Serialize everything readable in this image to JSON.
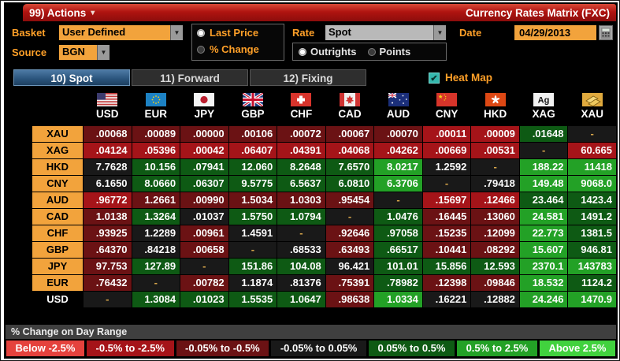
{
  "title_bar": {
    "actions_label": "99) Actions",
    "title": "Currency Rates Matrix (FXC)"
  },
  "controls": {
    "basket_label": "Basket",
    "basket_value": "User Defined",
    "source_label": "Source",
    "source_value": "BGN",
    "price_options": [
      {
        "label": "Last Price",
        "selected": true
      },
      {
        "label": "% Change",
        "selected": false
      }
    ],
    "rate_label": "Rate",
    "rate_value": "Spot",
    "rate_type_options": [
      {
        "label": "Outrights",
        "selected": true
      },
      {
        "label": "Points",
        "selected": false
      }
    ],
    "date_label": "Date",
    "date_value": "04/29/2013"
  },
  "tabs": [
    {
      "label": "10) Spot",
      "selected": true
    },
    {
      "label": "11) Forward",
      "selected": false
    },
    {
      "label": "12) Fixing",
      "selected": false
    }
  ],
  "heat_map": {
    "label": "Heat Map",
    "checked": true
  },
  "colors": {
    "accent_orange": "#f2a33c",
    "titlebar_red": "#b01410",
    "tab_selected_blue": "#2c567e",
    "heatmap_teal": "#35b7ad",
    "dash_amber": "#d8a64b",
    "screen_background": "#000000"
  },
  "heat_colors": {
    "br": "#e5423d",
    "mr": "#a51419",
    "dr": "#6b1214",
    "blk": "#191919",
    "dg": "#0e5a14",
    "mg": "#23a126",
    "bg": "#41d23e"
  },
  "matrix": {
    "columns": [
      {
        "code": "USD",
        "icon": "usd-flag-icon"
      },
      {
        "code": "EUR",
        "icon": "eur-flag-icon"
      },
      {
        "code": "JPY",
        "icon": "jpy-flag-icon"
      },
      {
        "code": "GBP",
        "icon": "gbp-flag-icon"
      },
      {
        "code": "CHF",
        "icon": "chf-flag-icon"
      },
      {
        "code": "CAD",
        "icon": "cad-flag-icon"
      },
      {
        "code": "AUD",
        "icon": "aud-flag-icon"
      },
      {
        "code": "CNY",
        "icon": "cny-flag-icon"
      },
      {
        "code": "HKD",
        "icon": "hkd-flag-icon"
      },
      {
        "code": "XAG",
        "icon": "silver-ag-icon"
      },
      {
        "code": "XAU",
        "icon": "gold-bars-icon"
      }
    ],
    "rows": [
      {
        "label": "XAU",
        "highlight": true,
        "cells": [
          [
            ".00068",
            "dr"
          ],
          [
            ".00089",
            "dr"
          ],
          [
            ".00000",
            "dr"
          ],
          [
            ".00106",
            "dr"
          ],
          [
            ".00072",
            "dr"
          ],
          [
            ".00067",
            "dr"
          ],
          [
            ".00070",
            "dr"
          ],
          [
            ".00011",
            "mr"
          ],
          [
            ".00009",
            "mr"
          ],
          [
            ".01648",
            "dg"
          ],
          [
            "-",
            "blk"
          ]
        ]
      },
      {
        "label": "XAG",
        "highlight": true,
        "cells": [
          [
            ".04124",
            "mr"
          ],
          [
            ".05396",
            "mr"
          ],
          [
            ".00042",
            "mr"
          ],
          [
            ".06407",
            "mr"
          ],
          [
            ".04391",
            "mr"
          ],
          [
            ".04068",
            "mr"
          ],
          [
            ".04262",
            "mr"
          ],
          [
            ".00669",
            "mr"
          ],
          [
            ".00531",
            "mr"
          ],
          [
            "-",
            "blk"
          ],
          [
            "60.665",
            "mr"
          ]
        ]
      },
      {
        "label": "HKD",
        "highlight": true,
        "cells": [
          [
            "7.7628",
            "blk"
          ],
          [
            "10.156",
            "dg"
          ],
          [
            ".07941",
            "dg"
          ],
          [
            "12.060",
            "dg"
          ],
          [
            "8.2648",
            "dg"
          ],
          [
            "7.6570",
            "dg"
          ],
          [
            "8.0217",
            "mg"
          ],
          [
            "1.2592",
            "blk"
          ],
          [
            "-",
            "blk"
          ],
          [
            "188.22",
            "mg"
          ],
          [
            "11418",
            "mg"
          ]
        ]
      },
      {
        "label": "CNY",
        "highlight": true,
        "cells": [
          [
            "6.1650",
            "blk"
          ],
          [
            "8.0660",
            "dg"
          ],
          [
            ".06307",
            "dg"
          ],
          [
            "9.5775",
            "dg"
          ],
          [
            "6.5637",
            "dg"
          ],
          [
            "6.0810",
            "dg"
          ],
          [
            "6.3706",
            "mg"
          ],
          [
            "-",
            "blk"
          ],
          [
            ".79418",
            "blk"
          ],
          [
            "149.48",
            "mg"
          ],
          [
            "9068.0",
            "mg"
          ]
        ]
      },
      {
        "label": "AUD",
        "highlight": true,
        "cells": [
          [
            ".96772",
            "mr"
          ],
          [
            "1.2661",
            "dr"
          ],
          [
            ".00990",
            "dr"
          ],
          [
            "1.5034",
            "dr"
          ],
          [
            "1.0303",
            "dr"
          ],
          [
            ".95454",
            "dr"
          ],
          [
            "-",
            "blk"
          ],
          [
            ".15697",
            "mr"
          ],
          [
            ".12466",
            "mr"
          ],
          [
            "23.464",
            "dg"
          ],
          [
            "1423.4",
            "dg"
          ]
        ]
      },
      {
        "label": "CAD",
        "highlight": true,
        "cells": [
          [
            "1.0138",
            "dr"
          ],
          [
            "1.3264",
            "dg"
          ],
          [
            ".01037",
            "blk"
          ],
          [
            "1.5750",
            "dg"
          ],
          [
            "1.0794",
            "dg"
          ],
          [
            "-",
            "blk"
          ],
          [
            "1.0476",
            "dg"
          ],
          [
            ".16445",
            "dr"
          ],
          [
            ".13060",
            "dr"
          ],
          [
            "24.581",
            "mg"
          ],
          [
            "1491.2",
            "dg"
          ]
        ]
      },
      {
        "label": "CHF",
        "highlight": true,
        "cells": [
          [
            ".93925",
            "dr"
          ],
          [
            "1.2289",
            "blk"
          ],
          [
            ".00961",
            "dr"
          ],
          [
            "1.4591",
            "blk"
          ],
          [
            "-",
            "blk"
          ],
          [
            ".92646",
            "dr"
          ],
          [
            ".97058",
            "dg"
          ],
          [
            ".15235",
            "dr"
          ],
          [
            ".12099",
            "dr"
          ],
          [
            "22.773",
            "mg"
          ],
          [
            "1381.5",
            "dg"
          ]
        ]
      },
      {
        "label": "GBP",
        "highlight": true,
        "cells": [
          [
            ".64370",
            "dr"
          ],
          [
            ".84218",
            "blk"
          ],
          [
            ".00658",
            "dr"
          ],
          [
            "-",
            "blk"
          ],
          [
            ".68533",
            "blk"
          ],
          [
            ".63493",
            "dr"
          ],
          [
            ".66517",
            "dg"
          ],
          [
            ".10441",
            "dr"
          ],
          [
            ".08292",
            "dr"
          ],
          [
            "15.607",
            "mg"
          ],
          [
            "946.81",
            "dg"
          ]
        ]
      },
      {
        "label": "JPY",
        "highlight": true,
        "cells": [
          [
            "97.753",
            "dr"
          ],
          [
            "127.89",
            "dg"
          ],
          [
            "-",
            "blk"
          ],
          [
            "151.86",
            "dg"
          ],
          [
            "104.08",
            "dg"
          ],
          [
            "96.421",
            "blk"
          ],
          [
            "101.01",
            "dg"
          ],
          [
            "15.856",
            "dg"
          ],
          [
            "12.593",
            "dg"
          ],
          [
            "2370.1",
            "mg"
          ],
          [
            "143783",
            "mg"
          ]
        ]
      },
      {
        "label": "EUR",
        "highlight": true,
        "cells": [
          [
            ".76432",
            "dr"
          ],
          [
            "-",
            "blk"
          ],
          [
            ".00782",
            "dr"
          ],
          [
            "1.1874",
            "blk"
          ],
          [
            ".81376",
            "blk"
          ],
          [
            ".75391",
            "dr"
          ],
          [
            ".78982",
            "dg"
          ],
          [
            ".12398",
            "dr"
          ],
          [
            ".09846",
            "dr"
          ],
          [
            "18.532",
            "mg"
          ],
          [
            "1124.2",
            "dg"
          ]
        ]
      },
      {
        "label": "USD",
        "highlight": false,
        "cells": [
          [
            "-",
            "blk"
          ],
          [
            "1.3084",
            "dg"
          ],
          [
            ".01023",
            "dg"
          ],
          [
            "1.5535",
            "dg"
          ],
          [
            "1.0647",
            "dg"
          ],
          [
            ".98638",
            "dr"
          ],
          [
            "1.0334",
            "mg"
          ],
          [
            ".16221",
            "blk"
          ],
          [
            ".12882",
            "blk"
          ],
          [
            "24.246",
            "mg"
          ],
          [
            "1470.9",
            "mg"
          ]
        ]
      }
    ]
  },
  "legend": {
    "title": "% Change on Day Range",
    "items": [
      {
        "label": "Below -2.5%",
        "key": "br"
      },
      {
        "label": "-0.5% to -2.5%",
        "key": "mr"
      },
      {
        "label": "-0.05% to -0.5%",
        "key": "dr"
      },
      {
        "label": "-0.05% to 0.05%",
        "key": "blk"
      },
      {
        "label": "0.05% to 0.5%",
        "key": "dg"
      },
      {
        "label": "0.5% to 2.5%",
        "key": "mg"
      },
      {
        "label": "Above 2.5%",
        "key": "bg"
      }
    ]
  }
}
